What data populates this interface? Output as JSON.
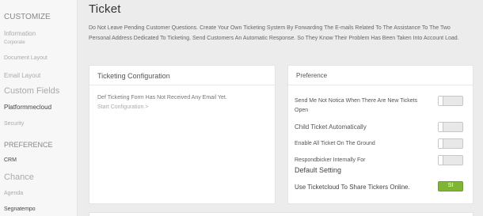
{
  "sidebar": {
    "customize": "CUSTOMIZE",
    "information": "Information",
    "corporate": "Corporate",
    "document_layout": "Document Layout",
    "email_layout": "Email Layout",
    "custom_fields": "Custom Fields",
    "platformmecloud": "Platformmecloud",
    "security": "Security",
    "preference": "PREFERENCE",
    "crm": "CRM",
    "chance": "Chance",
    "agenda": "Agenda",
    "segnatempo": "Segnatempo"
  },
  "page": {
    "title": "Ticket",
    "description": "Do Not Leave Pending Customer Questions. Create Your Own Ticketing System By Forwarding The E-mails Related To The Assistance To The Two Personal Address Dedicated To Ticketing. Send Customers An Automatic Response. So They Know Their Problem Has Been Taken Into Account Load."
  },
  "config": {
    "title": "Ticketing Configuration",
    "warning": "Def Ticketing Form Has Not Received Any Email Yet.",
    "start": "Start Configuration >"
  },
  "preference": {
    "title": "Preference",
    "items": [
      {
        "label1": "Send Me Not Notica When There Are New Tickets",
        "label2": "Open",
        "on": false
      },
      {
        "label1": "Child Ticket Automatically",
        "on": false
      },
      {
        "label1": "Enable All Ticket On The Ground",
        "on": false
      },
      {
        "label1": "Respondbicker Internally For",
        "label2": "Default Setting",
        "on": false
      },
      {
        "label1": "Use Ticketcloud To Share Tickers Online.",
        "on": true,
        "on_label": "SI"
      }
    ]
  }
}
